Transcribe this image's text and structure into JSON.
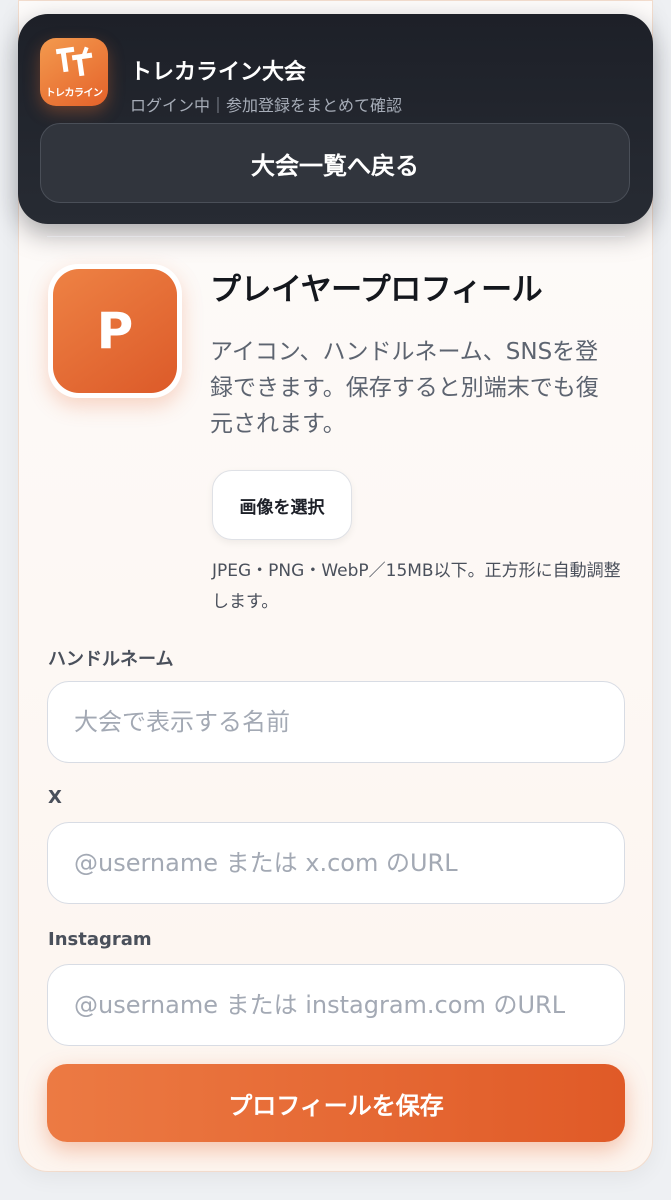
{
  "header": {
    "logo_text": "トレカライン",
    "app_title": "トレカライン大会",
    "subtitle": "ログイン中｜参加登録をまとめて確認",
    "back_label": "大会一覧へ戻る"
  },
  "profile": {
    "avatar_letter": "P",
    "title": "プレイヤープロフィール",
    "description": "アイコン、ハンドルネーム、SNSを登録できます。保存すると別端末でも復元されます。",
    "choose_image_label": "画像を選択",
    "image_hint": "JPEG・PNG・WebP／15MB以下。正方形に自動調整します。"
  },
  "form": {
    "handle_label": "ハンドルネーム",
    "handle_placeholder": "大会で表示する名前",
    "x_label": "X",
    "x_placeholder": "@username または x.com のURL",
    "instagram_label": "Instagram",
    "instagram_placeholder": "@username または instagram.com のURL",
    "save_label": "プロフィールを保存"
  },
  "colors": {
    "accent": "#e5622a",
    "header_bg": "#1d2028"
  }
}
